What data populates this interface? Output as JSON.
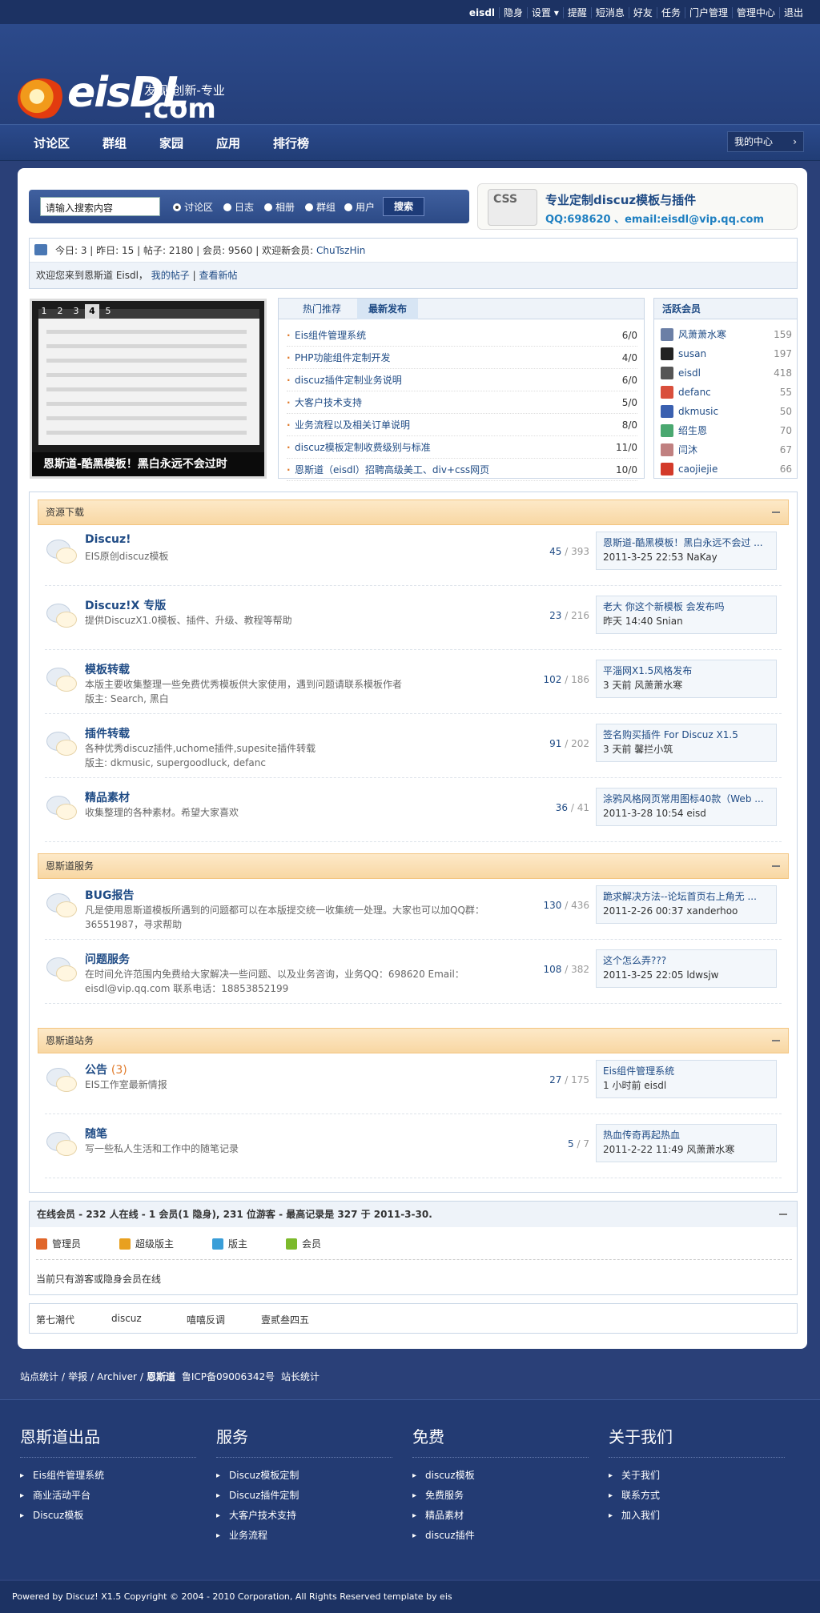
{
  "topbar": {
    "links": [
      "eisdl",
      "隐身",
      "设置 ▾",
      "提醒",
      "短消息",
      "好友",
      "任务",
      "门户管理",
      "管理中心",
      "退出"
    ]
  },
  "header": {
    "logo_text": "eisDL",
    "logo_com": ".com",
    "slogan": "发现-创新-专业"
  },
  "nav": {
    "items": [
      "讨论区",
      "群组",
      "家园",
      "应用",
      "排行榜"
    ],
    "mycenter": "我的中心",
    "mycenter_arrow": "›"
  },
  "search": {
    "placeholder": "请输入搜索内容",
    "options": [
      "讨论区",
      "日志",
      "相册",
      "群组",
      "用户"
    ],
    "button": "搜索"
  },
  "ad": {
    "badge": "CSS",
    "title": "专业定制discuz模板与插件",
    "contact": "QQ:698620 、email:eisdl@vip.qq.com"
  },
  "stats": {
    "line1": "今日: 3 | 昨日: 15 | 帖子: 2180 | 会员: 9560 | 欢迎新会员: ",
    "new_member": "ChuTszHin",
    "welcome": "欢迎您来到恩斯道 Eisdl，",
    "my_posts": "我的帖子",
    "view_new": "查看新帖"
  },
  "slide": {
    "nums": [
      "1",
      "2",
      "3",
      "4",
      "5"
    ],
    "caption": "恩斯道-酷黑模板！黑白永远不会过时"
  },
  "hot": {
    "tabs": [
      "热门推荐",
      "最新发布"
    ],
    "items": [
      {
        "title": "Eis组件管理系统",
        "count": "6/0"
      },
      {
        "title": "PHP功能组件定制开发",
        "count": "4/0"
      },
      {
        "title": "discuz插件定制业务说明",
        "count": "6/0"
      },
      {
        "title": "大客户技术支持",
        "count": "5/0"
      },
      {
        "title": "业务流程以及相关订单说明",
        "count": "8/0"
      },
      {
        "title": "discuz模板定制收费级别与标准",
        "count": "11/0"
      },
      {
        "title": "恩斯道（eisdl）招聘高级美工、div+css网页",
        "count": "10/0"
      }
    ]
  },
  "members": {
    "title": "活跃会员",
    "items": [
      {
        "name": "风萧萧水寒",
        "count": "159",
        "color": "#6b7fa6"
      },
      {
        "name": "susan",
        "count": "197",
        "color": "#222222"
      },
      {
        "name": "eisdl",
        "count": "418",
        "color": "#555555"
      },
      {
        "name": "defanc",
        "count": "55",
        "color": "#d94f3c"
      },
      {
        "name": "dkmusic",
        "count": "50",
        "color": "#3a60b0"
      },
      {
        "name": "绍生恩",
        "count": "70",
        "color": "#4aa870"
      },
      {
        "name": "闫沐",
        "count": "67",
        "color": "#c08080"
      },
      {
        "name": "caojiejie",
        "count": "66",
        "color": "#d33a2a"
      }
    ]
  },
  "categories": [
    {
      "title": "资源下载",
      "forums": [
        {
          "name": "Discuz!",
          "desc": "EIS原创discuz模板",
          "topics": "45",
          "posts": "393",
          "last_title": "恩斯道-酷黑模板！黑白永远不会过 ...",
          "last_meta": "2011-3-25 22:53 NaKay"
        },
        {
          "name": "Discuz!X 专版",
          "desc": "提供DiscuzX1.0模板、插件、升级、教程等帮助",
          "topics": "23",
          "posts": "216",
          "last_title": "老大 你这个新模板 会发布吗",
          "last_meta": "昨天 14:40 Snian"
        },
        {
          "name": "模板转载",
          "desc": "本版主要收集整理一些免费优秀模板供大家使用，遇到问题请联系模板作者",
          "mods": "版主: Search, 黑白",
          "topics": "102",
          "posts": "186",
          "last_title": "平淄网X1.5风格发布",
          "last_meta": "3 天前 风萧萧水寒"
        },
        {
          "name": "插件转载",
          "desc": "各种优秀discuz插件,uchome插件,supesite插件转载",
          "mods": "版主: dkmusic, supergoodluck, defanc",
          "topics": "91",
          "posts": "202",
          "last_title": "签名购买插件 For Discuz X1.5",
          "last_meta": "3 天前 馨拦小筑"
        },
        {
          "name": "精品素材",
          "desc": "收集整理的各种素材。希望大家喜欢",
          "topics": "36",
          "posts": "41",
          "last_title": "涂鸦风格网页常用图标40款（Web ...",
          "last_meta": "2011-3-28 10:54 eisd"
        }
      ]
    },
    {
      "title": "恩斯道服务",
      "forums": [
        {
          "name": "BUG报告",
          "desc": "凡是使用恩斯道模板所遇到的问题都可以在本版提交统一收集统一处理。大家也可以加QQ群：36551987，寻求帮助",
          "topics": "130",
          "posts": "436",
          "last_title": "跪求解决方法--论坛首页右上角无 ...",
          "last_meta": "2011-2-26 00:37 xanderhoo"
        },
        {
          "name": "问题服务",
          "desc": "在时间允许范围内免费给大家解决一些问题、以及业务咨询，业务QQ：698620 Email：eisdl@vip.qq.com 联系电话：18853852199",
          "topics": "108",
          "posts": "382",
          "last_title": "这个怎么弄???",
          "last_meta": "2011-3-25 22:05 ldwsjw"
        }
      ]
    },
    {
      "title": "恩斯道站务",
      "forums": [
        {
          "name": "公告",
          "badge": "(3)",
          "desc": "EIS工作室最新情报",
          "topics": "27",
          "posts": "175",
          "last_title": "Eis组件管理系统",
          "last_meta": "1 小时前 eisdl"
        },
        {
          "name": "随笔",
          "desc": "写一些私人生活和工作中的随笔记录",
          "topics": "5",
          "posts": "7",
          "last_title": "热血传奇再起热血",
          "last_meta": "2011-2-22 11:49 风萧萧水寒"
        }
      ]
    }
  ],
  "online": {
    "title": "在线会员 - 232 人在线 - 1 会员(1 隐身), 231 位游客 - 最高记录是 327 于 2011-3-30.",
    "legend": [
      "管理员",
      "超级版主",
      "版主",
      "会员"
    ],
    "legend_colors": [
      "#e0662a",
      "#e8a020",
      "#3a9ed8",
      "#7cba2c"
    ],
    "message": "当前只有游客或隐身会员在线"
  },
  "friend_links": [
    "第七潮代",
    "discuz",
    "嘻嘻反调",
    "壹贰叁四五"
  ],
  "footnav": [
    "站点统计",
    "/",
    "举报",
    "/",
    "Archiver",
    "/",
    "恩斯道",
    "鲁ICP备09006342号",
    "站长统计"
  ],
  "footer": {
    "cols": [
      {
        "title": "恩斯道出品",
        "links": [
          "Eis组件管理系统",
          "商业活动平台",
          "Discuz模板"
        ]
      },
      {
        "title": "服务",
        "links": [
          "Discuz模板定制",
          "Discuz插件定制",
          "大客户技术支持",
          "业务流程"
        ]
      },
      {
        "title": "免费",
        "links": [
          "discuz模板",
          "免费服务",
          "精品素材",
          "discuz插件"
        ]
      },
      {
        "title": "关于我们",
        "links": [
          "关于我们",
          "联系方式",
          "加入我们"
        ]
      }
    ],
    "copyright": "Powered by Discuz! X1.5 Copyright © 2004 - 2010 Corporation, All Rights Reserved  template by eis"
  }
}
